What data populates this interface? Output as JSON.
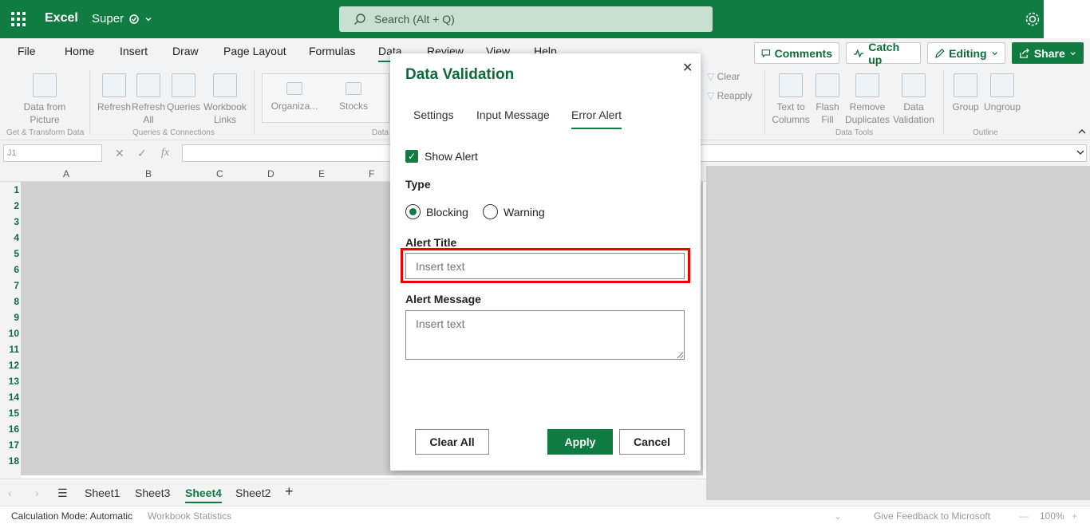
{
  "app": {
    "name": "Excel",
    "doc_name": "Super"
  },
  "search": {
    "placeholder": "Search (Alt + Q)"
  },
  "menu": {
    "items": [
      "File",
      "Home",
      "Insert",
      "Draw",
      "Page Layout",
      "Formulas",
      "Data",
      "Review",
      "View",
      "Help"
    ],
    "active": "Data",
    "comments": "Comments",
    "catch_up": "Catch up",
    "editing": "Editing",
    "share": "Share"
  },
  "ribbon": {
    "data_from_picture": "Data from Picture",
    "refresh": "Refresh",
    "refresh_all": "Refresh All",
    "queries": "Queries",
    "workbook_links": "Workbook Links",
    "organization": "Organiza...",
    "stocks": "Stocks",
    "clear": "Clear",
    "reapply": "Reapply",
    "text_to_columns": "Text to Columns",
    "flash_fill": "Flash Fill",
    "remove_duplicates": "Remove Duplicates",
    "data_validation": "Data Validation",
    "group": "Group",
    "ungroup": "Ungroup",
    "groups": {
      "get_transform": "Get & Transform Data",
      "queries_connections": "Queries & Connections",
      "data_types": "Data",
      "data_tools": "Data Tools",
      "outline": "Outline"
    }
  },
  "formula_bar": {
    "name_box": "J1",
    "fx": "fx"
  },
  "grid": {
    "columns": [
      "A",
      "B",
      "C",
      "D",
      "E",
      "F"
    ],
    "rows": [
      "1",
      "2",
      "3",
      "4",
      "5",
      "6",
      "7",
      "8",
      "9",
      "10",
      "11",
      "12",
      "13",
      "14",
      "15",
      "16",
      "17",
      "18"
    ]
  },
  "sheets": {
    "tabs": [
      "Sheet1",
      "Sheet3",
      "Sheet4",
      "Sheet2"
    ],
    "active": "Sheet4"
  },
  "status": {
    "calc_mode": "Calculation Mode: Automatic",
    "workbook_stats": "Workbook Statistics",
    "feedback": "Give Feedback to Microsoft",
    "zoom": "100%"
  },
  "dialog": {
    "title": "Data Validation",
    "tabs": [
      "Settings",
      "Input Message",
      "Error Alert"
    ],
    "active_tab": "Error Alert",
    "show_alert_label": "Show Alert",
    "show_alert_checked": true,
    "type_label": "Type",
    "type_options": [
      "Blocking",
      "Warning"
    ],
    "type_selected": "Blocking",
    "alert_title_label": "Alert Title",
    "alert_title_placeholder": "Insert text",
    "alert_message_label": "Alert Message",
    "alert_message_placeholder": "Insert text",
    "clear_all": "Clear All",
    "apply": "Apply",
    "cancel": "Cancel"
  },
  "colors": {
    "brand": "#107c41",
    "highlight": "#e00000"
  }
}
